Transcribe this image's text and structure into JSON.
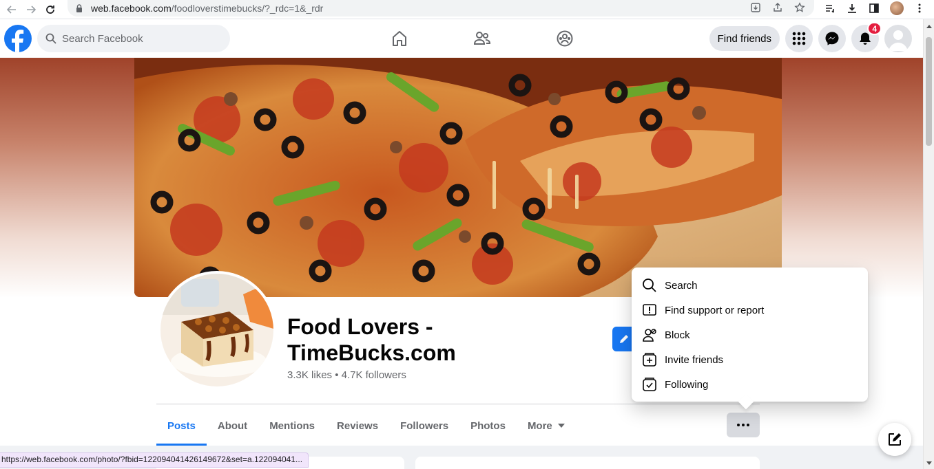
{
  "browser": {
    "url_domain": "web.facebook.com",
    "url_path": "/foodloverstimebucks/?_rdc=1&_rdr",
    "status_url": "https://web.facebook.com/photo/?fbid=122094041426149672&set=a.122094041..."
  },
  "header": {
    "search_placeholder": "Search Facebook",
    "find_friends_label": "Find friends",
    "notification_count": "4"
  },
  "page": {
    "name": "Food Lovers - TimeBucks.com",
    "stats": "3.3K likes • 4.7K followers"
  },
  "tabs": [
    {
      "label": "Posts",
      "active": true
    },
    {
      "label": "About"
    },
    {
      "label": "Mentions"
    },
    {
      "label": "Reviews"
    },
    {
      "label": "Followers"
    },
    {
      "label": "Photos"
    },
    {
      "label": "More"
    }
  ],
  "dropdown": {
    "items": [
      {
        "label": "Search",
        "icon": "search-icon"
      },
      {
        "label": "Find support or report",
        "icon": "report-icon"
      },
      {
        "label": "Block",
        "icon": "block-user-icon"
      },
      {
        "label": "Invite friends",
        "icon": "invite-icon"
      },
      {
        "label": "Following",
        "icon": "following-icon"
      }
    ]
  },
  "colors": {
    "brand": "#1877f2",
    "badge": "#e41e3f"
  }
}
